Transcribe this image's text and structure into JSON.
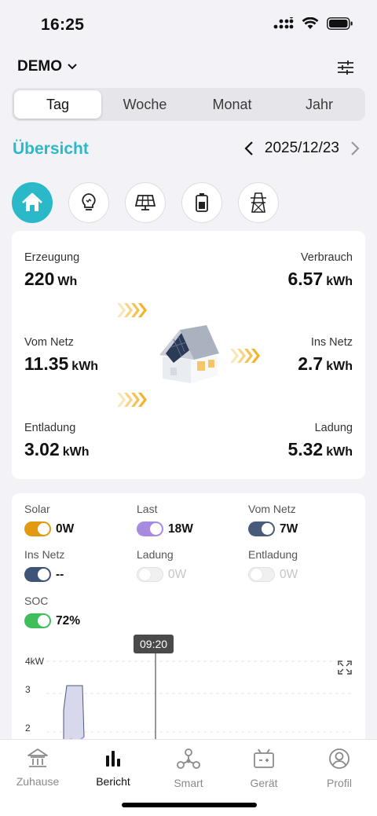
{
  "status_bar": {
    "time": "16:25"
  },
  "header": {
    "account": "DEMO"
  },
  "period_tabs": [
    {
      "label": "Tag"
    },
    {
      "label": "Woche"
    },
    {
      "label": "Monat"
    },
    {
      "label": "Jahr"
    }
  ],
  "selected_period": "Tag",
  "overview": {
    "title": "Übersicht",
    "date": "2025/12/23"
  },
  "categories": [
    "home-icon",
    "bulb-icon",
    "solar-panel-icon",
    "battery-icon",
    "grid-tower-icon"
  ],
  "energy": {
    "erzeugung": {
      "label": "Erzeugung",
      "value": "220",
      "unit": "Wh"
    },
    "verbrauch": {
      "label": "Verbrauch",
      "value": "6.57",
      "unit": "kWh"
    },
    "vom_netz": {
      "label": "Vom Netz",
      "value": "11.35",
      "unit": "kWh"
    },
    "ins_netz": {
      "label": "Ins Netz",
      "value": "2.7",
      "unit": "kWh"
    },
    "entladung": {
      "label": "Entladung",
      "value": "3.02",
      "unit": "kWh"
    },
    "ladung": {
      "label": "Ladung",
      "value": "5.32",
      "unit": "kWh"
    }
  },
  "power": {
    "solar": {
      "label": "Solar",
      "value": "0W",
      "color": "#e29a0f",
      "enabled": true
    },
    "last": {
      "label": "Last",
      "value": "18W",
      "color": "#a78bdf",
      "enabled": true
    },
    "vom_netz": {
      "label": "Vom Netz",
      "value": "7W",
      "color": "#4a5a7a",
      "enabled": true
    },
    "ins_netz": {
      "label": "Ins Netz",
      "value": "--",
      "color": "#3f5577",
      "enabled": true
    },
    "ladung": {
      "label": "Ladung",
      "value": "0W",
      "enabled": false
    },
    "entladung": {
      "label": "Entladung",
      "value": "0W",
      "enabled": false
    },
    "soc": {
      "label": "SOC",
      "value": "72%",
      "color": "#3fbe5a",
      "enabled": true
    }
  },
  "chart": {
    "tooltip_time": "09:20",
    "y_unit_label": "4kW",
    "y_ticks": [
      "3",
      "2"
    ]
  },
  "tabbar": [
    {
      "label": "Zuhause",
      "icon": "house-icon"
    },
    {
      "label": "Bericht",
      "icon": "bar-chart-icon"
    },
    {
      "label": "Smart",
      "icon": "smart-network-icon"
    },
    {
      "label": "Gerät",
      "icon": "device-icon"
    },
    {
      "label": "Profil",
      "icon": "profile-icon"
    }
  ],
  "active_tab": "Bericht",
  "colors": {
    "accent": "#2bb8c9",
    "arrow": "#f5b730"
  }
}
